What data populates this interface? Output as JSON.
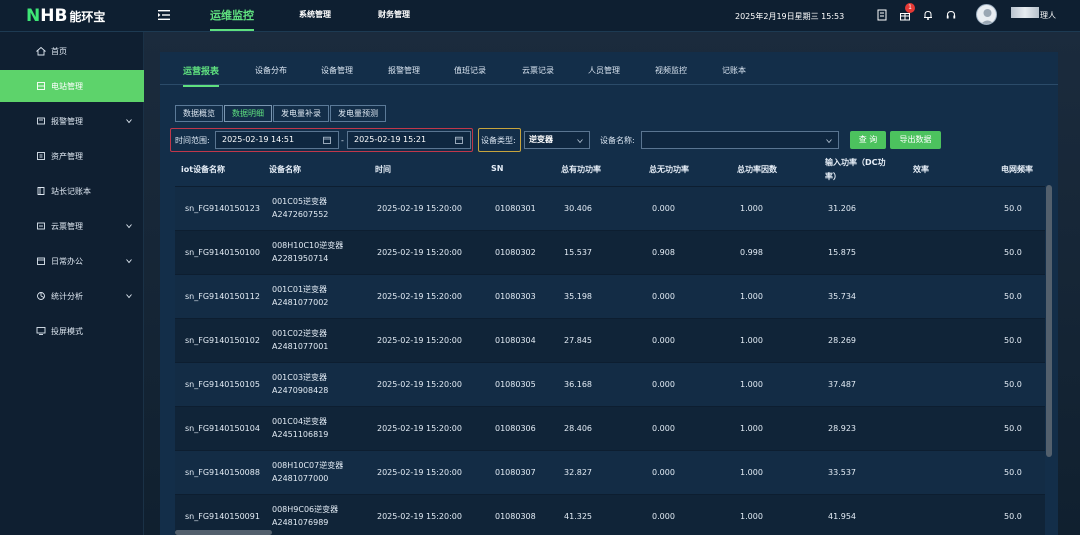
{
  "logo": {
    "n": "N",
    "hb": "HB",
    "cn": "能环宝"
  },
  "topnav": [
    "运维监控",
    "系统管理",
    "财务管理"
  ],
  "datetime": "2025年2月19日星期三 15:53",
  "notification_count": "1",
  "username_suffix": "理人",
  "sidebar": [
    {
      "label": "首页",
      "icon": "home-icon"
    },
    {
      "label": "电站管理",
      "icon": "station-icon"
    },
    {
      "label": "报警管理",
      "icon": "alarm-icon"
    },
    {
      "label": "资产管理",
      "icon": "asset-icon"
    },
    {
      "label": "站长记账本",
      "icon": "ledger-icon"
    },
    {
      "label": "云票管理",
      "icon": "cloud-icon"
    },
    {
      "label": "日常办公",
      "icon": "office-icon"
    },
    {
      "label": "统计分析",
      "icon": "stats-icon"
    },
    {
      "label": "投屏模式",
      "icon": "screen-icon"
    }
  ],
  "tabs": [
    "运营报表",
    "设备分布",
    "设备管理",
    "报警管理",
    "值班记录",
    "云票记录",
    "人员管理",
    "视频监控",
    "记账本"
  ],
  "subtabs": [
    "数据概览",
    "数据明细",
    "发电量补录",
    "发电量预测"
  ],
  "filters": {
    "time_label": "时间范围:",
    "start": "2025-02-19 14:51",
    "dash": "-",
    "end": "2025-02-19 15:21",
    "type_label": "设备类型:",
    "type_value": "逆变器",
    "name_label": "设备名称:",
    "query_btn": "查 询",
    "export_btn": "导出数据"
  },
  "table": {
    "headers": [
      "iot设备名称",
      "设备名称",
      "时间",
      "SN",
      "总有功功率",
      "总无功功率",
      "总功率因数",
      "输入功率（DC功",
      "率）",
      "效率",
      "电网频率"
    ],
    "rows": [
      [
        "sn_FG9140150123",
        "001C05逆变器",
        "A2472607552",
        "2025-02-19 15:20:00",
        "01080301",
        "30.406",
        "0.000",
        "1.000",
        "31.206",
        "50.0"
      ],
      [
        "sn_FG9140150100",
        "008H10C10逆变器",
        "A2281950714",
        "2025-02-19 15:20:00",
        "01080302",
        "15.537",
        "0.908",
        "0.998",
        "15.875",
        "50.0"
      ],
      [
        "sn_FG9140150112",
        "001C01逆变器",
        "A2481077002",
        "2025-02-19 15:20:00",
        "01080303",
        "35.198",
        "0.000",
        "1.000",
        "35.734",
        "50.0"
      ],
      [
        "sn_FG9140150102",
        "001C02逆变器",
        "A2481077001",
        "2025-02-19 15:20:00",
        "01080304",
        "27.845",
        "0.000",
        "1.000",
        "28.269",
        "50.0"
      ],
      [
        "sn_FG9140150105",
        "001C03逆变器",
        "A2470908428",
        "2025-02-19 15:20:00",
        "01080305",
        "36.168",
        "0.000",
        "1.000",
        "37.487",
        "50.0"
      ],
      [
        "sn_FG9140150104",
        "001C04逆变器",
        "A2451106819",
        "2025-02-19 15:20:00",
        "01080306",
        "28.406",
        "0.000",
        "1.000",
        "28.923",
        "50.0"
      ],
      [
        "sn_FG9140150088",
        "008H10C07逆变器",
        "A2481077000",
        "2025-02-19 15:20:00",
        "01080307",
        "32.827",
        "0.000",
        "1.000",
        "33.537",
        "50.0"
      ],
      [
        "sn_FG9140150091",
        "008H9C06逆变器",
        "A2481076989",
        "2025-02-19 15:20:00",
        "01080308",
        "41.325",
        "0.000",
        "1.000",
        "41.954",
        "50.0"
      ]
    ]
  }
}
